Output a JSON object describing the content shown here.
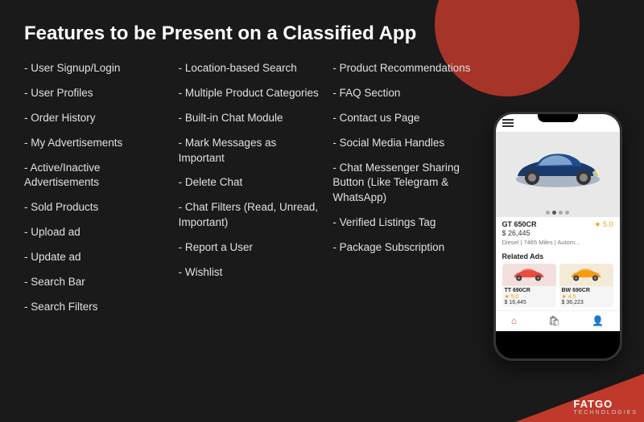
{
  "page": {
    "title": "Features to be Present on a Classified App",
    "background_color": "#1a1a1a",
    "accent_color": "#c0392b"
  },
  "columns": {
    "col1": {
      "items": [
        "User Signup/Login",
        "User Profiles",
        "Order History",
        "My Advertisements",
        "Active/Inactive Advertisements",
        "Sold Products",
        "Upload ad",
        "Update ad",
        "Search Bar",
        "Search Filters"
      ]
    },
    "col2": {
      "items": [
        "Location-based Search",
        "Multiple Product Categories",
        "Built-in Chat Module",
        "Mark Messages as Important",
        "Delete Chat",
        "Chat Filters (Read, Unread, Important)",
        "Report a User",
        "Wishlist"
      ]
    },
    "col3": {
      "items": [
        "Product Recommendations",
        "FAQ Section",
        "Contact us Page",
        "Social Media Handles",
        "Chat Messenger Sharing Button (Like Telegram & WhatsApp)",
        "Verified Listings Tag",
        "Package Subscription"
      ]
    }
  },
  "phone": {
    "car": {
      "name": "GT 650CR",
      "price": "$ 26,445",
      "rating": "5.0",
      "specs": "Diesel  |  7465 Miles  |  Autom..."
    },
    "related_title": "Related Ads",
    "related_cars": [
      {
        "name": "TT 690CR",
        "rating": "5.0",
        "price": "$ 16,445",
        "color": "#e74c3c"
      },
      {
        "name": "BW 690CR",
        "rating": "4.5",
        "price": "$ 36,223",
        "color": "#f39c12"
      }
    ]
  },
  "logo": {
    "brand": "FATGO",
    "sub": "TECHNOLOGIES"
  }
}
